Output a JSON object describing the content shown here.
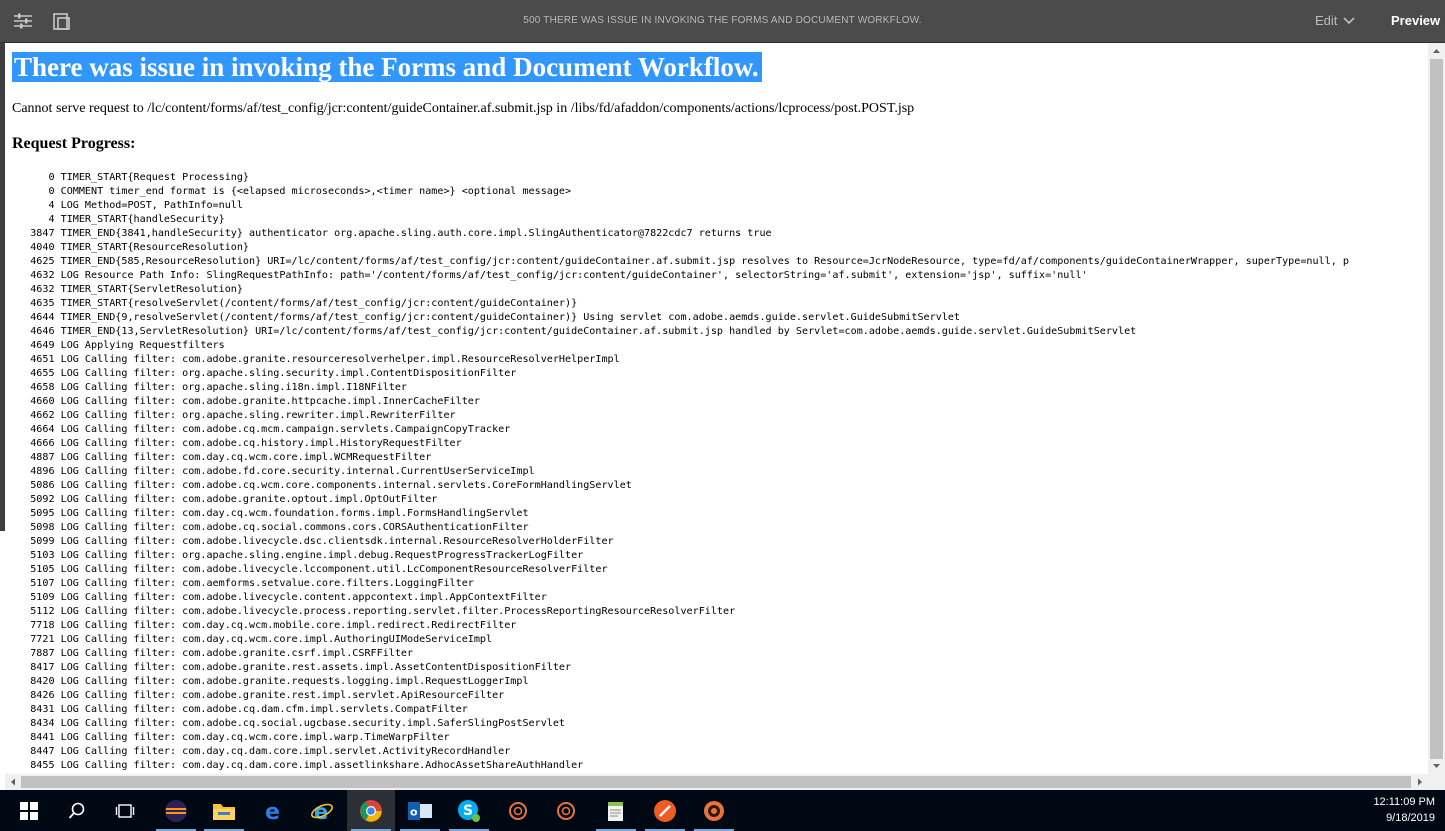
{
  "toolbar": {
    "title": "500 THERE WAS ISSUE IN INVOKING THE FORMS AND DOCUMENT WORKFLOW.",
    "edit_label": "Edit",
    "preview_label": "Preview"
  },
  "page": {
    "heading": "There was issue in invoking the Forms and Document Workflow.",
    "message": "Cannot serve request to /lc/content/forms/af/test_config/jcr:content/guideContainer.af.submit.jsp in /libs/fd/afaddon/components/actions/lcprocess/post.POST.jsp",
    "progress_heading": "Request Progress:"
  },
  "log_lines": [
    "      0 TIMER_START{Request Processing}",
    "      0 COMMENT timer_end format is {<elapsed microseconds>,<timer name>} <optional message>",
    "      4 LOG Method=POST, PathInfo=null",
    "      4 TIMER_START{handleSecurity}",
    "   3847 TIMER_END{3841,handleSecurity} authenticator org.apache.sling.auth.core.impl.SlingAuthenticator@7822cdc7 returns true",
    "   4040 TIMER_START{ResourceResolution}",
    "   4625 TIMER_END{585,ResourceResolution} URI=/lc/content/forms/af/test_config/jcr:content/guideContainer.af.submit.jsp resolves to Resource=JcrNodeResource, type=fd/af/components/guideContainerWrapper, superType=null, p",
    "   4632 LOG Resource Path Info: SlingRequestPathInfo: path='/content/forms/af/test_config/jcr:content/guideContainer', selectorString='af.submit', extension='jsp', suffix='null'",
    "   4632 TIMER_START{ServletResolution}",
    "   4635 TIMER_START{resolveServlet(/content/forms/af/test_config/jcr:content/guideContainer)}",
    "   4644 TIMER_END{9,resolveServlet(/content/forms/af/test_config/jcr:content/guideContainer)} Using servlet com.adobe.aemds.guide.servlet.GuideSubmitServlet",
    "   4646 TIMER_END{13,ServletResolution} URI=/lc/content/forms/af/test_config/jcr:content/guideContainer.af.submit.jsp handled by Servlet=com.adobe.aemds.guide.servlet.GuideSubmitServlet",
    "   4649 LOG Applying Requestfilters",
    "   4651 LOG Calling filter: com.adobe.granite.resourceresolverhelper.impl.ResourceResolverHelperImpl",
    "   4655 LOG Calling filter: org.apache.sling.security.impl.ContentDispositionFilter",
    "   4658 LOG Calling filter: org.apache.sling.i18n.impl.I18NFilter",
    "   4660 LOG Calling filter: com.adobe.granite.httpcache.impl.InnerCacheFilter",
    "   4662 LOG Calling filter: org.apache.sling.rewriter.impl.RewriterFilter",
    "   4664 LOG Calling filter: com.adobe.cq.mcm.campaign.servlets.CampaignCopyTracker",
    "   4666 LOG Calling filter: com.adobe.cq.history.impl.HistoryRequestFilter",
    "   4887 LOG Calling filter: com.day.cq.wcm.core.impl.WCMRequestFilter",
    "   4896 LOG Calling filter: com.adobe.fd.core.security.internal.CurrentUserServiceImpl",
    "   5086 LOG Calling filter: com.adobe.cq.wcm.core.components.internal.servlets.CoreFormHandlingServlet",
    "   5092 LOG Calling filter: com.adobe.granite.optout.impl.OptOutFilter",
    "   5095 LOG Calling filter: com.day.cq.wcm.foundation.forms.impl.FormsHandlingServlet",
    "   5098 LOG Calling filter: com.adobe.cq.social.commons.cors.CORSAuthenticationFilter",
    "   5099 LOG Calling filter: com.adobe.livecycle.dsc.clientsdk.internal.ResourceResolverHolderFilter",
    "   5103 LOG Calling filter: org.apache.sling.engine.impl.debug.RequestProgressTrackerLogFilter",
    "   5105 LOG Calling filter: com.adobe.livecycle.lccomponent.util.LcComponentResourceResolverFilter",
    "   5107 LOG Calling filter: com.aemforms.setvalue.core.filters.LoggingFilter",
    "   5109 LOG Calling filter: com.adobe.livecycle.content.appcontext.impl.AppContextFilter",
    "   5112 LOG Calling filter: com.adobe.livecycle.process.reporting.servlet.filter.ProcessReportingResourceResolverFilter",
    "   7718 LOG Calling filter: com.day.cq.wcm.mobile.core.impl.redirect.RedirectFilter",
    "   7721 LOG Calling filter: com.day.cq.wcm.core.impl.AuthoringUIModeServiceImpl",
    "   7887 LOG Calling filter: com.adobe.granite.csrf.impl.CSRFFilter",
    "   8417 LOG Calling filter: com.adobe.granite.rest.assets.impl.AssetContentDispositionFilter",
    "   8420 LOG Calling filter: com.adobe.granite.requests.logging.impl.RequestLoggerImpl",
    "   8426 LOG Calling filter: com.adobe.granite.rest.impl.servlet.ApiResourceFilter",
    "   8431 LOG Calling filter: com.adobe.cq.dam.cfm.impl.servlets.CompatFilter",
    "   8434 LOG Calling filter: com.adobe.cq.social.ugcbase.security.impl.SaferSlingPostServlet",
    "   8441 LOG Calling filter: com.day.cq.wcm.core.impl.warp.TimeWarpFilter",
    "   8447 LOG Calling filter: com.day.cq.dam.core.impl.servlet.ActivityRecordHandler",
    "   8455 LOG Calling filter: com.day.cq.dam.core.impl.assetlinkshare.AdhocAssetShareAuthHandler"
  ],
  "taskbar": {
    "items": [
      "start",
      "search",
      "task-view",
      "eclipse",
      "file-explorer",
      "edge",
      "internet-explorer",
      "chrome",
      "outlook",
      "skype",
      "app-circle-1",
      "app-circle-2",
      "notepad-plus-plus",
      "postman",
      "app-gear"
    ],
    "clock_time": "12:11:09 PM",
    "clock_date": "9/18/2019"
  },
  "colors": {
    "toolbar_bg": "#4b4b4b",
    "selection_bg": "#3297fd",
    "taskbar_bg": "#000814"
  }
}
